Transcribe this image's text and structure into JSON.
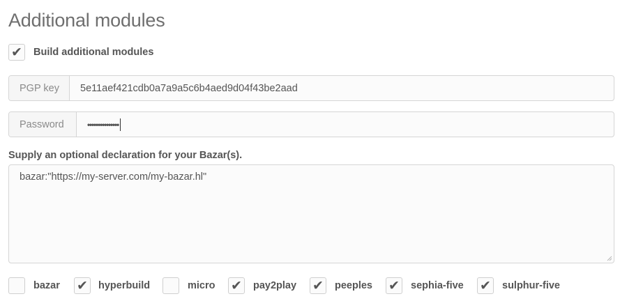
{
  "title": "Additional modules",
  "build_option": {
    "label": "Build additional modules",
    "checked": true
  },
  "pgp": {
    "label": "PGP key",
    "value": "5e11aef421cdb0a7a9a5c6b4aed9d04f43be2aad"
  },
  "password": {
    "label": "Password",
    "masked_value": "•••••••••••••••"
  },
  "declaration": {
    "label": "Supply an optional declaration for your Bazar(s).",
    "value": "bazar:\"https://my-server.com/my-bazar.hl\""
  },
  "modules": [
    {
      "label": "bazar",
      "checked": false
    },
    {
      "label": "hyperbuild",
      "checked": true
    },
    {
      "label": "micro",
      "checked": false
    },
    {
      "label": "pay2play",
      "checked": true
    },
    {
      "label": "peeples",
      "checked": true
    },
    {
      "label": "sephia-five",
      "checked": true
    },
    {
      "label": "sulphur-five",
      "checked": true
    }
  ],
  "icons": {
    "check": "checkmark-icon",
    "resize": "resize-grip-icon"
  },
  "tick_glyph": "✔"
}
